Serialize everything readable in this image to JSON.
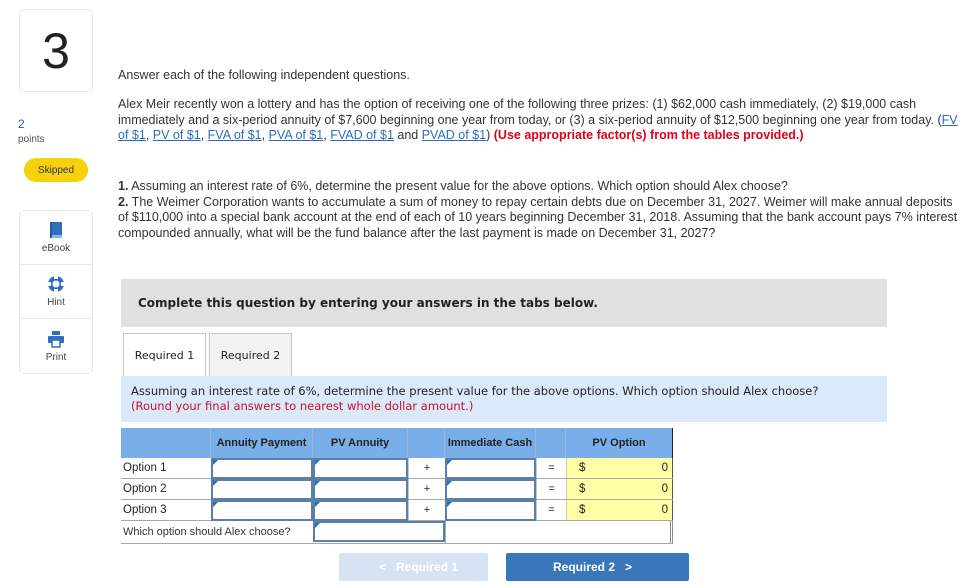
{
  "question": {
    "number": "3",
    "points_value": "2",
    "points_label": "points",
    "status": "Skipped"
  },
  "tools": [
    {
      "label": "eBook",
      "icon": "book-icon"
    },
    {
      "label": "Hint",
      "icon": "lifebuoy-icon"
    },
    {
      "label": "Print",
      "icon": "printer-icon"
    }
  ],
  "content": {
    "intro": "Answer each of the following independent questions.",
    "para_text": "Alex Meir recently won a lottery and has the option of receiving one of the following three prizes: (1) $62,000 cash immediately, (2) $19,000 cash immediately and a six-period annuity of $7,600 beginning one year from today, or (3) a six-period annuity of $12,500 beginning one year from today. (",
    "links": [
      "FV of $1",
      "PV of $1",
      "FVA of $1",
      "PVA of $1",
      "FVAD of $1",
      "PVAD of $1"
    ],
    "sep_comma": ", ",
    "sep_and": " and ",
    "close_paren": ")",
    "factor_note": "(Use appropriate factor(s) from the tables provided.)",
    "req1_num": "1.",
    "req1_text": " Assuming an interest rate of 6%, determine the present value for the above options. Which option should Alex choose?",
    "req2_num": "2.",
    "req2_text": " The Weimer Corporation wants to accumulate a sum of money to repay certain debts due on December 31, 2027. Weimer will make annual deposits of $110,000 into a special bank account at the end of each of 10 years beginning December 31, 2018. Assuming that the bank account pays 7% interest compounded annually, what will be the fund balance after the last payment is made on December 31, 2027?"
  },
  "complete_bar": "Complete this question by entering your answers in the tabs below.",
  "tabs": [
    {
      "label": "Required 1",
      "active": true
    },
    {
      "label": "Required 2",
      "active": false
    }
  ],
  "instruction": {
    "text": "Assuming an interest rate of 6%, determine the present value for the above options. Which option should Alex choose?",
    "note": "(Round your final answers to nearest whole dollar amount.)"
  },
  "table": {
    "headers": {
      "annuity_payment": "Annuity Payment",
      "pv_annuity": "PV Annuity",
      "immediate_cash": "Immediate Cash",
      "pv_option": "PV Option"
    },
    "rows": [
      {
        "label": "Option 1",
        "annuity_payment": "",
        "pv_annuity": "",
        "plus": "+",
        "immediate_cash": "",
        "equals": "=",
        "currency": "$",
        "pv_option": "0"
      },
      {
        "label": "Option 2",
        "annuity_payment": "",
        "pv_annuity": "",
        "plus": "+",
        "immediate_cash": "",
        "equals": "=",
        "currency": "$",
        "pv_option": "0"
      },
      {
        "label": "Option 3",
        "annuity_payment": "",
        "pv_annuity": "",
        "plus": "+",
        "immediate_cash": "",
        "equals": "=",
        "currency": "$",
        "pv_option": "0"
      }
    ],
    "choose_label": "Which option should Alex choose?",
    "choose_value": ""
  },
  "nav": {
    "prev_label": "Required 1",
    "next_label": "Required 2",
    "prev_chevron": "<",
    "next_chevron": ">"
  },
  "colors": {
    "header_blue": "#79aee8",
    "instruction_bg": "#dbeaf8",
    "computed_yellow": "#ffffa6",
    "skipped_yellow": "#f5d20c",
    "next_button": "#3a76ba",
    "warning_red": "#e0001b"
  }
}
